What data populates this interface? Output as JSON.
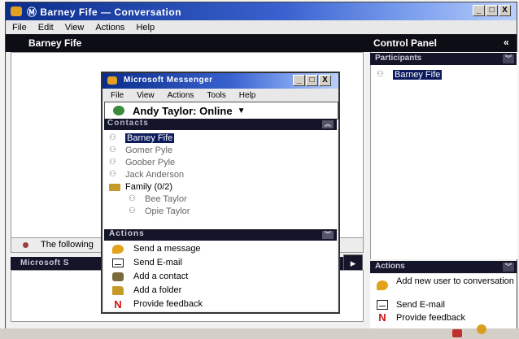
{
  "main_window": {
    "title": "Ⓜ Barney Fife — Conversation",
    "menu": [
      "File",
      "Edit",
      "View",
      "Actions",
      "Help"
    ],
    "buttons": [
      "_",
      "□",
      "X"
    ]
  },
  "conversation": {
    "header": "Barney Fife",
    "status_text": "The following",
    "message_bar_label": "Microsoft S"
  },
  "control_panel": {
    "header": "Control Panel",
    "collapse_glyph": "«",
    "participants_label": "Participants",
    "participants": [
      "Barney Fife"
    ],
    "actions_label": "Actions",
    "actions": [
      {
        "label": "Add new user to conversation",
        "icon": "chat-bubble-icon"
      },
      {
        "label": "Send E-mail",
        "icon": "mail-icon"
      },
      {
        "label": "Provide feedback",
        "icon": "feedback-n-icon"
      }
    ]
  },
  "contact_window": {
    "title": "Microsoft Messenger",
    "menu": [
      "File",
      "View",
      "Actions",
      "Tools",
      "Help"
    ],
    "buttons": [
      "_",
      "□",
      "X"
    ],
    "user_status": "Andy Taylor: Online",
    "contacts_label": "Contacts",
    "contacts": [
      "Barney Fife",
      "Gomer Pyle",
      "Goober Pyle",
      "Jack Anderson"
    ],
    "group": {
      "label": "Family (0/2)",
      "members": [
        "Bee Taylor",
        "Opie Taylor"
      ]
    },
    "actions_label": "Actions",
    "actions": [
      {
        "label": "Send a message",
        "icon": "chat-bubble-icon"
      },
      {
        "label": "Send E-mail",
        "icon": "mail-icon"
      },
      {
        "label": "Add a contact",
        "icon": "add-contact-icon"
      },
      {
        "label": "Add a folder",
        "icon": "folder-icon"
      },
      {
        "label": "Provide feedback",
        "icon": "feedback-n-icon"
      }
    ]
  },
  "colors": {
    "title_gradient_start": "#0b2d8a",
    "section_bar": "#15152a",
    "highlight": "#0b1a5c"
  }
}
